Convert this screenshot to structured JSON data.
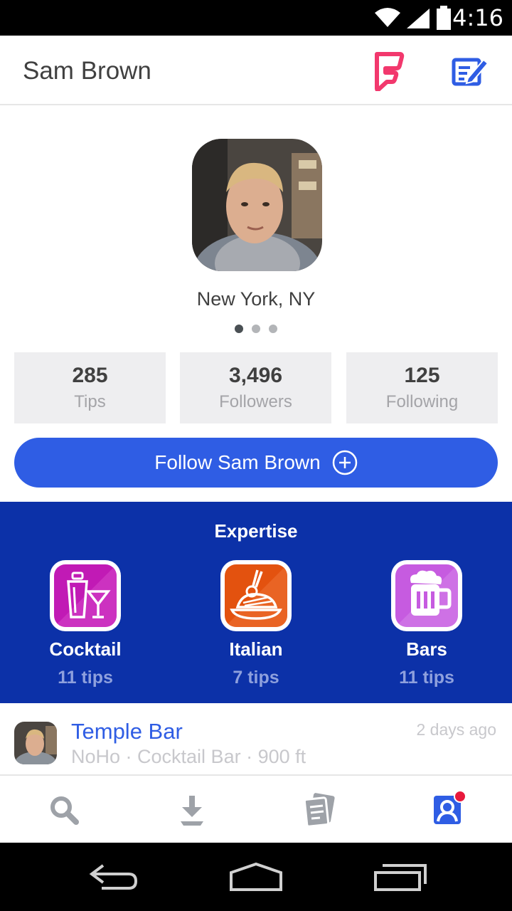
{
  "status_bar": {
    "time": "4:16"
  },
  "header": {
    "title": "Sam Brown"
  },
  "profile": {
    "location": "New York, NY",
    "stats": [
      {
        "value": "285",
        "label": "Tips"
      },
      {
        "value": "3,496",
        "label": "Followers"
      },
      {
        "value": "125",
        "label": "Following"
      }
    ],
    "follow_label": "Follow Sam Brown"
  },
  "expertise": {
    "title": "Expertise",
    "items": [
      {
        "name": "Cocktail",
        "tips": "11 tips",
        "icon": "cocktail-shaker-icon",
        "color": "#c11ab5"
      },
      {
        "name": "Italian",
        "tips": "7 tips",
        "icon": "pasta-icon",
        "color": "#e3520f"
      },
      {
        "name": "Bars",
        "tips": "11 tips",
        "icon": "beer-mug-icon",
        "color": "#c65be0"
      }
    ]
  },
  "tip": {
    "venue": "Temple Bar",
    "meta": "NoHo · Cocktail Bar · 900 ft",
    "time": "2 days ago"
  },
  "colors": {
    "accent": "#2f5de4",
    "expertise_bg": "#0c31a8",
    "foursquare_pink": "#f2386d"
  }
}
